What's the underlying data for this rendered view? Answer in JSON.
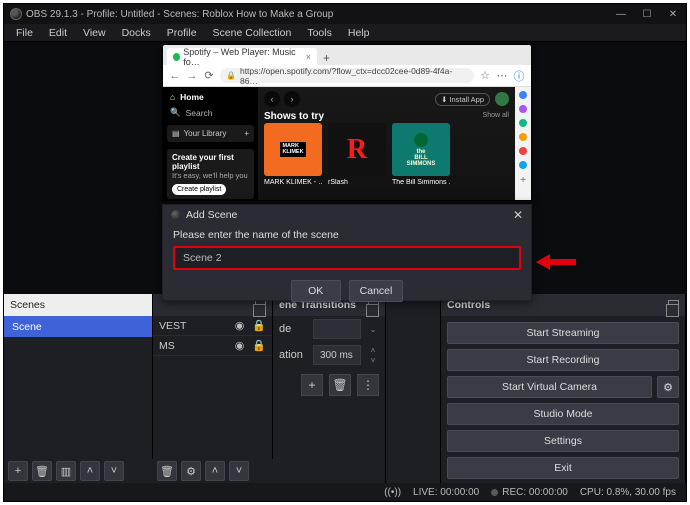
{
  "title": "OBS 29.1.3 - Profile: Untitled - Scenes: Roblox How to Make a Group",
  "menu": [
    "File",
    "Edit",
    "View",
    "Docks",
    "Profile",
    "Scene Collection",
    "Tools",
    "Help"
  ],
  "scenes_dock": {
    "title": "Scenes",
    "items": [
      "Scene"
    ]
  },
  "sources_dock": {
    "items": [
      {
        "label": "VEST"
      },
      {
        "label": "MS"
      }
    ]
  },
  "transitions_dock": {
    "title": "ene Transitions",
    "mode_label": "de",
    "duration_label": "ation",
    "duration_value": "300 ms"
  },
  "controls": {
    "title": "Controls",
    "start_streaming": "Start Streaming",
    "start_recording": "Start Recording",
    "start_vc": "Start Virtual Camera",
    "studio_mode": "Studio Mode",
    "settings": "Settings",
    "exit": "Exit"
  },
  "statusbar": {
    "live": "LIVE: 00:00:00",
    "rec": "REC: 00:00:00",
    "cpu": "CPU: 0.8%, 30.00 fps"
  },
  "browser": {
    "tab_title": "Spotify – Web Player: Music fo…",
    "url": "https://open.spotify.com/?flow_ctx=dcc02cee-0d89-4f4a-86…",
    "nav_home": "Home",
    "nav_search": "Search",
    "your_library": "Your Library",
    "playlist_card_title": "Create your first playlist",
    "playlist_card_sub": "It's easy, we'll help you",
    "create_playlist_btn": "Create playlist",
    "install_app": "Install App",
    "shows_to_try": "Shows to try",
    "show_all": "Show all",
    "cards": [
      {
        "title": "MARK KLIMEK - …",
        "line1": "MARK",
        "line2": "KLIMEK"
      },
      {
        "title": "rSlash"
      },
      {
        "title": "The Bill Simmons …",
        "line1": "BILL",
        "line2": "SIMMONS"
      }
    ]
  },
  "modal": {
    "title": "Add Scene",
    "prompt": "Please enter the name of the scene",
    "value": "Scene 2",
    "ok": "OK",
    "cancel": "Cancel"
  }
}
